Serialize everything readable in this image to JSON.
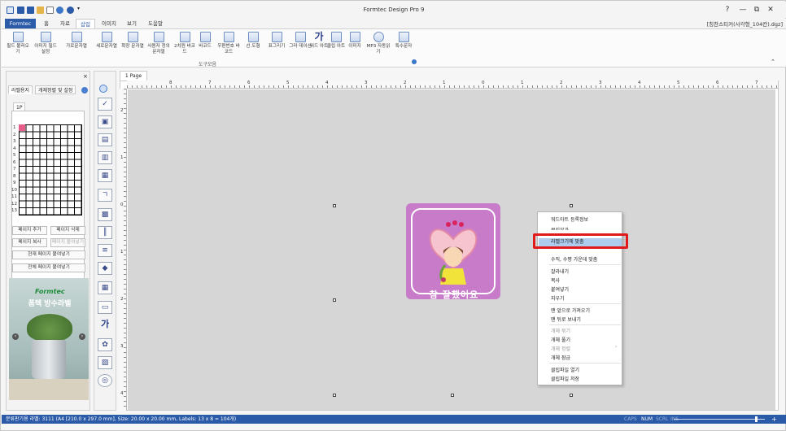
{
  "app": {
    "title": "Formtec Design Pro 9",
    "doc_path": "[칭찬스티커(사각형_104칸).dgz]"
  },
  "window_controls": {
    "help": "?",
    "restore": "—",
    "maximize": "⧉",
    "close": "✕"
  },
  "menu": {
    "tabs": [
      "Formtec",
      "홈",
      "자료",
      "삽입",
      "이미지",
      "보기",
      "도움말"
    ],
    "active": "삽입"
  },
  "ribbon": {
    "buttons": [
      {
        "label": "필드 불러오기"
      },
      {
        "label": "이미지 필드 설정"
      },
      {
        "label": "가로문자열"
      },
      {
        "label": "세로문자열"
      },
      {
        "label": "확장 문자열"
      },
      {
        "label": "사용자 정의문자열"
      },
      {
        "label": "2차원 바코드"
      },
      {
        "label": "바코드"
      },
      {
        "label": "우편번호 바코드"
      },
      {
        "label": "선.도형"
      },
      {
        "label": "표그리기"
      },
      {
        "label": "그라 데이션"
      },
      {
        "label": "워드 아트"
      },
      {
        "label": "클립 아트"
      },
      {
        "label": "이미지"
      },
      {
        "label": "MP3 자동읽기"
      },
      {
        "label": "특수문자"
      }
    ],
    "group_label": "도구모음"
  },
  "left_panel": {
    "tabs": [
      "라벨용지",
      "개체정렬 및 설정"
    ],
    "page_tab": "1P",
    "row_numbers": [
      "1",
      "2",
      "3",
      "4",
      "5",
      "6",
      "7",
      "8",
      "9",
      "10",
      "11",
      "12",
      "13"
    ],
    "buttons": {
      "add_page": "페이지 추가",
      "delete_page": "페이지 삭제",
      "copy_page": "페이지 복사",
      "paste_page": "페이지 붙여넣기",
      "paste_current": "현재 페이지 붙여넣기",
      "paste_all": "전체 페이지 붙여넣기"
    },
    "ad": {
      "brand": "Formtec",
      "headline": "폼텍 방수라벨"
    }
  },
  "document": {
    "tab": "1 Page",
    "vruler_labels": [
      "2",
      "1",
      "0",
      "1",
      "2",
      "3",
      "4"
    ],
    "hruler_labels": [
      "8",
      "7",
      "6",
      "5",
      "4",
      "3",
      "2",
      "1",
      "0",
      "1",
      "2",
      "3",
      "4",
      "5",
      "6",
      "7",
      "8"
    ],
    "sticker_text": "참 잘했어요"
  },
  "context_menu": {
    "items": [
      {
        "label": "워드아트 등록정보",
        "enabled": true
      },
      {
        "label": "묶지부가",
        "enabled": true
      },
      {
        "label": "라벨크기에 맞춤",
        "enabled": true,
        "highlighted": true
      },
      {
        "label": "수직, 수평 가운데 맞춤",
        "enabled": true
      },
      {
        "label": "잘라내기",
        "enabled": true
      },
      {
        "label": "복사",
        "enabled": true
      },
      {
        "label": "붙여넣기",
        "enabled": true
      },
      {
        "label": "지우기",
        "enabled": true
      },
      {
        "label": "맨 앞으로 가져오기",
        "enabled": true
      },
      {
        "label": "맨 뒤로 보내기",
        "enabled": true
      },
      {
        "label": "개체 묶기",
        "enabled": false
      },
      {
        "label": "개체 풀기",
        "enabled": true
      },
      {
        "label": "개체 정렬",
        "enabled": false
      },
      {
        "label": "개체 잠금",
        "enabled": true
      },
      {
        "label": "클립파일 열기",
        "enabled": true
      },
      {
        "label": "클립파일 저장",
        "enabled": true
      }
    ],
    "submenu_arrow": "›"
  },
  "status": {
    "text": "분류판기용 라벨: 3111 (A4 [210.0 x 297.0 mm], Size: 20.00 x 20.00 mm,  Labels: 13 x 8 = 104개)",
    "keys": [
      "CAPS",
      "NUM",
      "SCRL",
      "INS"
    ],
    "zoom_minus": "−",
    "zoom_plus": "+"
  },
  "colors": {
    "accent": "#2a5aa8",
    "sticker": "#c77bc9",
    "highlight": "#aeccee",
    "callout": "#e11b1b"
  }
}
